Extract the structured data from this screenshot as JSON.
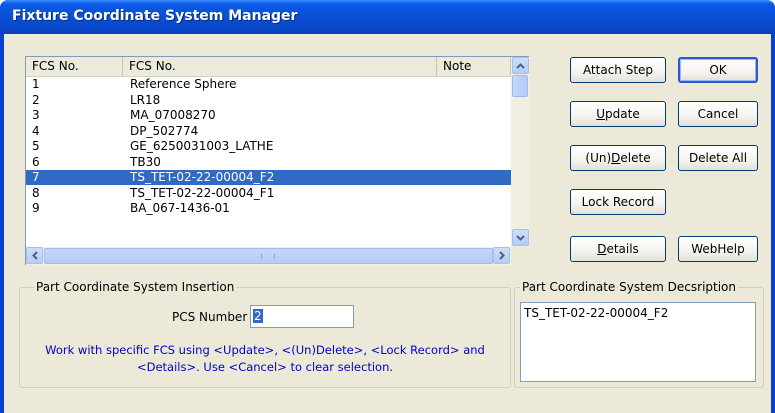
{
  "window": {
    "title": "Fixture Coordinate System Manager"
  },
  "list": {
    "columns": [
      "FCS No.",
      "FCS No.",
      "Note"
    ],
    "rows": [
      {
        "no": "1",
        "name": "Reference Sphere"
      },
      {
        "no": "2",
        "name": "LR18"
      },
      {
        "no": "3",
        "name": "MA_07008270"
      },
      {
        "no": "4",
        "name": "DP_502774"
      },
      {
        "no": "5",
        "name": "GE_6250031003_LATHE"
      },
      {
        "no": "6",
        "name": "TB30"
      },
      {
        "no": "7",
        "name": "TS_TET-02-22-00004_F2"
      },
      {
        "no": "8",
        "name": "TS_TET-02-22-00004_F1"
      },
      {
        "no": "9",
        "name": "BA_067-1436-01"
      }
    ],
    "selected_index": 6
  },
  "buttons": {
    "attach_step": "Attach Step",
    "ok": "OK",
    "update": "Update",
    "cancel": "Cancel",
    "undelete": "(Un)Delete",
    "delete_all": "Delete All",
    "lock_record": "Lock Record",
    "details": "Details",
    "webhelp": "WebHelp"
  },
  "insertion": {
    "group_label": "Part Coordinate System Insertion",
    "pcs_label": "PCS Number ->",
    "pcs_value": "2",
    "info": "Work with specific FCS using <Update>, <(Un)Delete>, <Lock Record> and <Details>. Use <Cancel> to clear selection."
  },
  "description": {
    "group_label": "Part Coordinate System Decsription",
    "value": "TS_TET-02-22-00004_F2"
  },
  "colors": {
    "title_bar": "#0a4fd6",
    "selection": "#316ac5",
    "info_text": "#0000cc",
    "dialog_bg": "#ece9d8"
  }
}
